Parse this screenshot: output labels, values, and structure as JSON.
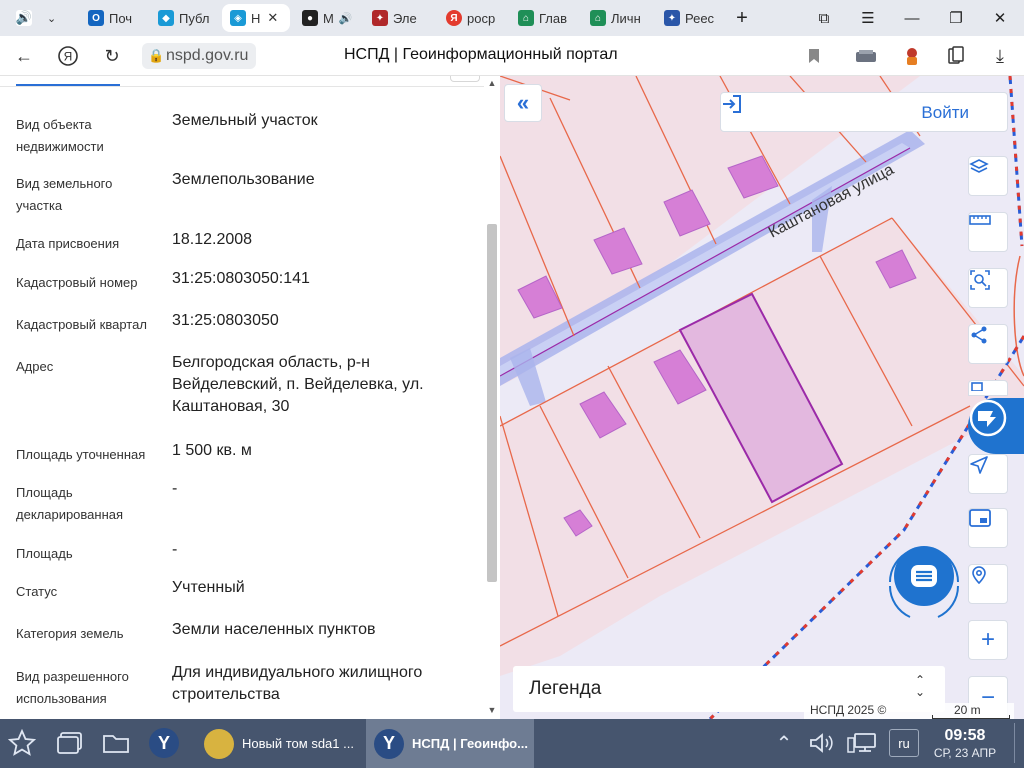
{
  "browser": {
    "tabs": [
      {
        "label": "",
        "favicon": "sound-icon",
        "color": "#5a6680",
        "active": false
      },
      {
        "label": "Поч",
        "favicon": "outlook-icon",
        "color": "#1466c0",
        "active": false
      },
      {
        "label": "Публ",
        "favicon": "chrome-store-icon",
        "color": "#1a9ad6",
        "active": false
      },
      {
        "label": "Н",
        "favicon": "nspd-icon",
        "color": "#1a9ad6",
        "active": true
      },
      {
        "label": "М",
        "favicon": "music-icon",
        "color": "#222222",
        "active": false
      },
      {
        "label": "Эле",
        "favicon": "emblem-icon",
        "color": "#b0282a",
        "active": false
      },
      {
        "label": "роср",
        "favicon": "yandex-icon",
        "color": "#e33b2e",
        "active": false
      },
      {
        "label": "Глав",
        "favicon": "rosreestr-icon",
        "color": "#1f8f57",
        "active": false
      },
      {
        "label": "Личн",
        "favicon": "rosreestr-icon",
        "color": "#1f8f57",
        "active": false
      },
      {
        "label": "Реес",
        "favicon": "emblem-icon",
        "color": "#2a56a8",
        "active": false
      }
    ],
    "new_tab": "+",
    "url": "nspd.gov.ru",
    "title": "НСПД | Геоинформационный портал"
  },
  "panel": {
    "fields": [
      {
        "label": "Вид объекта недвижимости",
        "value": "Земельный участок"
      },
      {
        "label": "Вид земельного участка",
        "value": "Землепользование"
      },
      {
        "label": "Дата присвоения",
        "value": "18.12.2008"
      },
      {
        "label": "Кадастровый номер",
        "value": "31:25:0803050:141"
      },
      {
        "label": "Кадастровый квартал",
        "value": "31:25:0803050"
      },
      {
        "label": "Адрес",
        "value": "Белгородская область, р-н Вейделевский, п. Вейделевка, ул. Каштановая, 30"
      },
      {
        "label": "Площадь уточненная",
        "value": "1 500 кв. м"
      },
      {
        "label": "Площадь декларированная",
        "value": "-"
      },
      {
        "label": "Площадь",
        "value": "-"
      },
      {
        "label": "Статус",
        "value": "Учтенный"
      },
      {
        "label": "Категория земель",
        "value": "Земли населенных пунктов"
      },
      {
        "label": "Вид разрешенного использования",
        "value": "Для индивидуального жилищного строительства"
      }
    ]
  },
  "map": {
    "street_label": "Каштановая улица",
    "login_label": "Войти",
    "legend_label": "Легенда",
    "copyright": "НСПД 2025 ©",
    "scale": "20 m",
    "tools": [
      "layers-icon",
      "ruler-icon",
      "area-select-icon",
      "share-icon",
      "print-icon",
      "navigate-icon",
      "screen-icon",
      "geo-search-icon",
      "zoom-in-icon",
      "zoom-out-icon"
    ],
    "colors": {
      "parcel_fill": "#f2dfe6",
      "parcel_line": "#e8684a",
      "building": "#d67fd6",
      "selected": "#9b2aa8",
      "road": "#aab4ec",
      "accent": "#2a6fd6"
    }
  },
  "taskbar": {
    "tasks": [
      {
        "label": "Новый том sda1 ..."
      },
      {
        "label": "НСПД | Геоинфо..."
      }
    ],
    "lang": "ru",
    "time": "09:58",
    "date": "СР, 23 АПР"
  }
}
